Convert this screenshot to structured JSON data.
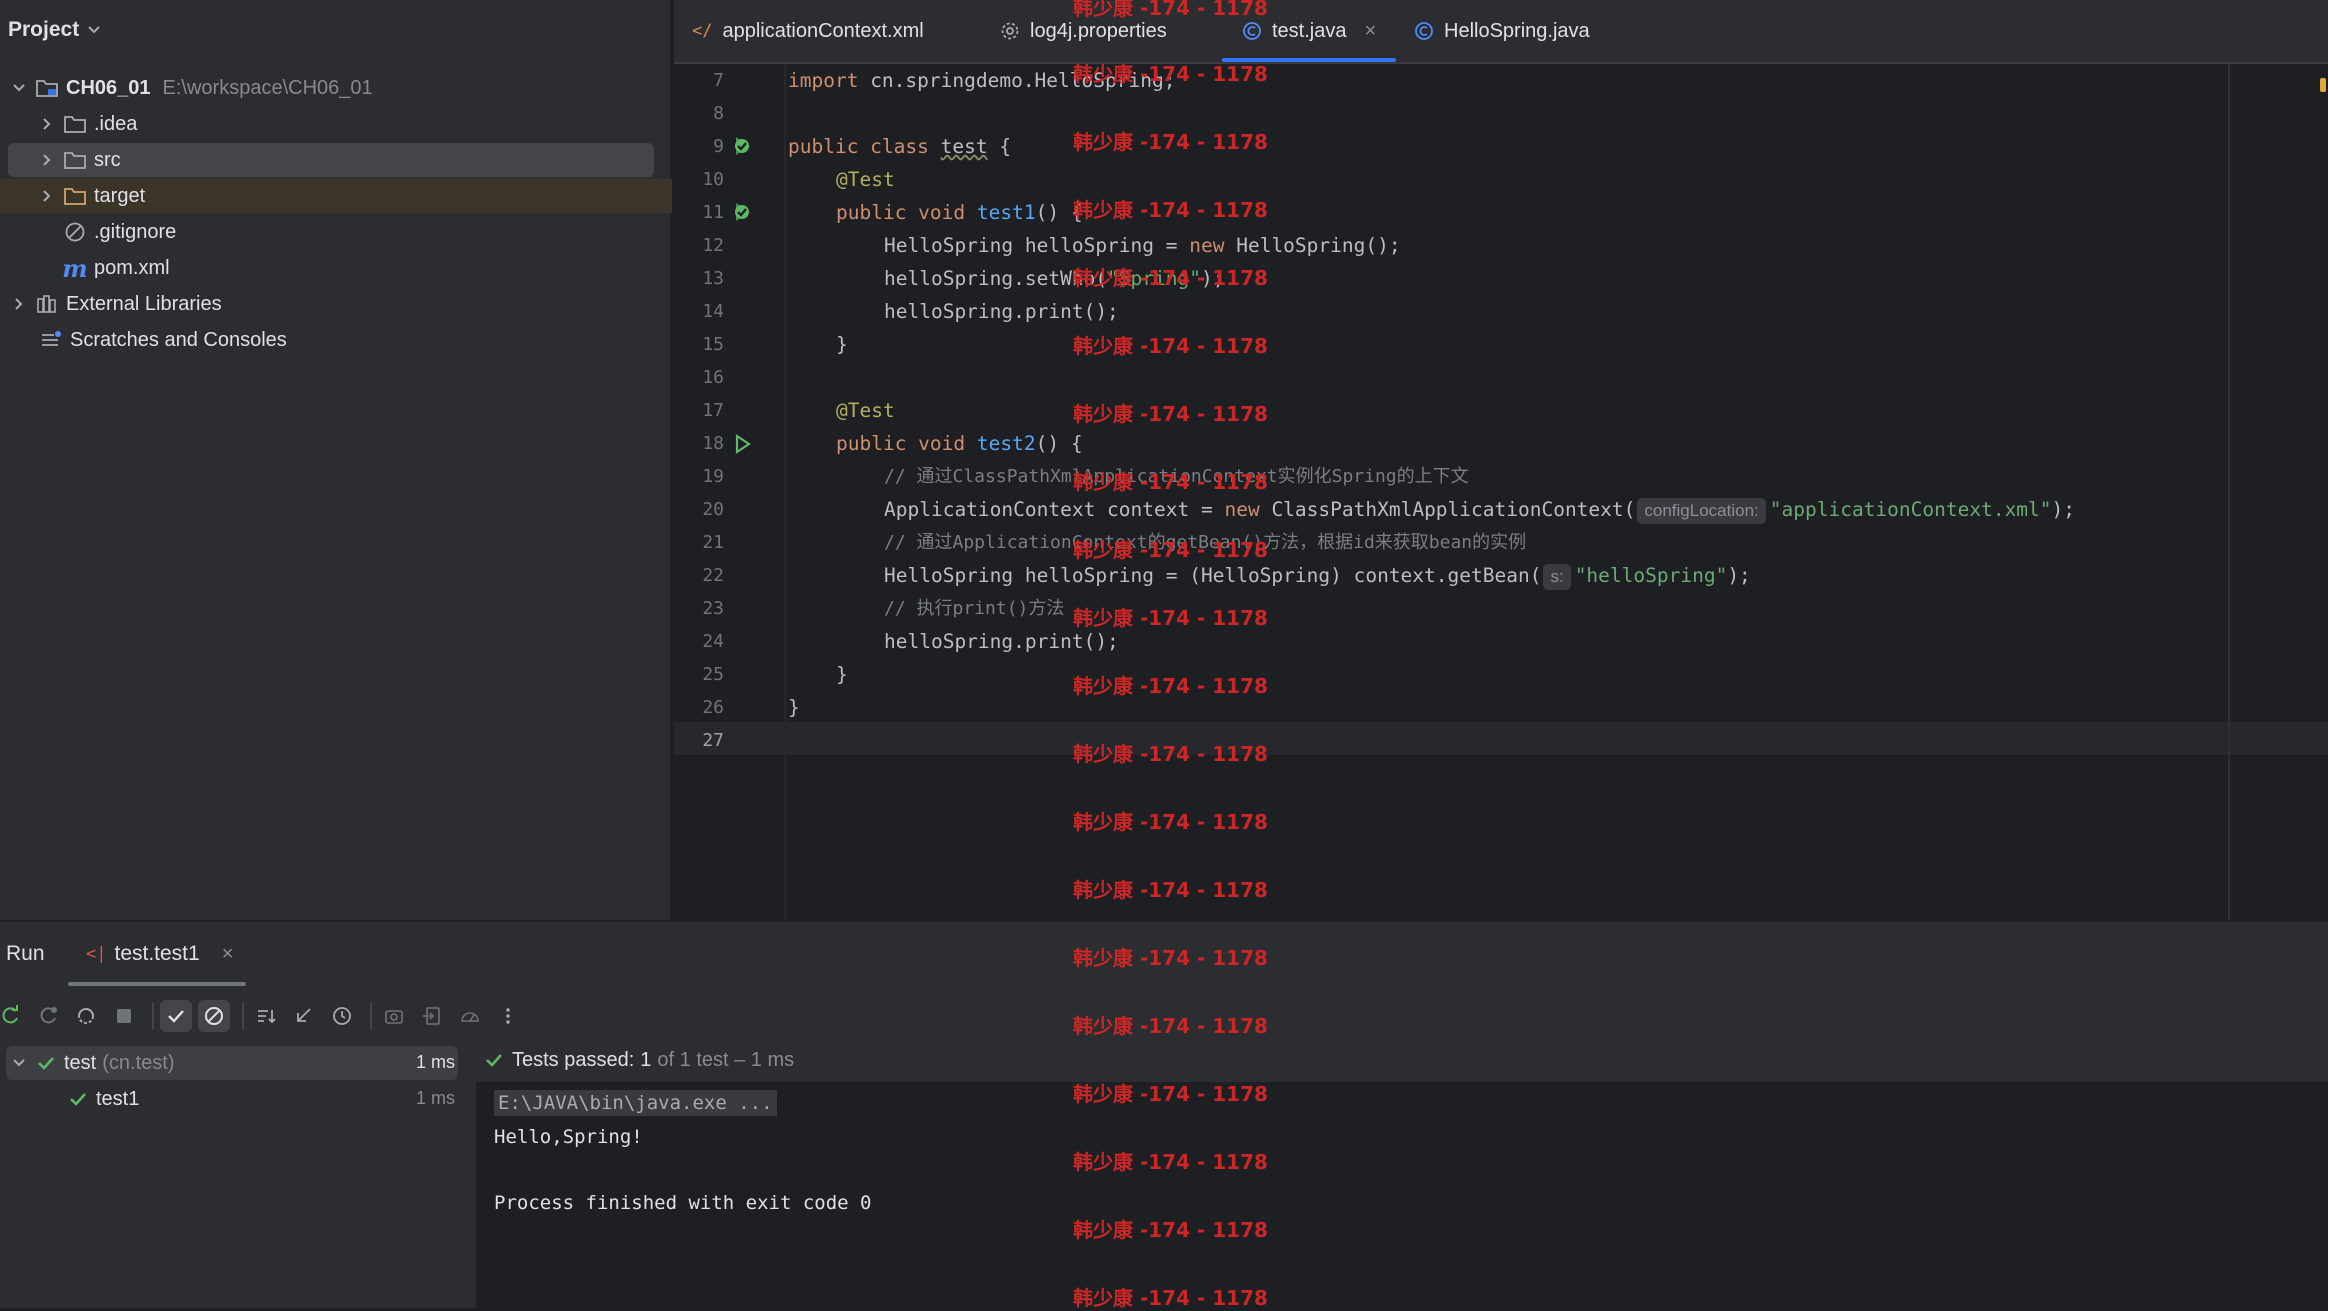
{
  "project": {
    "title": "Project",
    "root": {
      "name": "CH06_01",
      "path": "E:\\workspace\\CH06_01"
    },
    "items": [
      ".idea",
      "src",
      "target",
      ".gitignore",
      "pom.xml"
    ],
    "external_libraries": "External Libraries",
    "scratches": "Scratches and Consoles"
  },
  "tabs": [
    {
      "label": "applicationContext.xml",
      "icon": "xml-icon"
    },
    {
      "label": "log4j.properties",
      "icon": "gear-icon"
    },
    {
      "label": "test.java",
      "icon": "class-icon",
      "active": true
    },
    {
      "label": "HelloSpring.java",
      "icon": "class-icon"
    }
  ],
  "editor": {
    "line_numbers": [
      "7",
      "8",
      "9",
      "10",
      "11",
      "12",
      "13",
      "14",
      "15",
      "16",
      "17",
      "18",
      "19",
      "20",
      "21",
      "22",
      "23",
      "24",
      "25",
      "26",
      "27"
    ],
    "lines": {
      "l7": [
        "import",
        " cn.springdemo.HelloSpring;"
      ],
      "l9": [
        "public class",
        " ",
        "test",
        " {"
      ],
      "l10": "@Test",
      "l11": [
        "public void",
        " ",
        "test1",
        "() {"
      ],
      "l12": [
        "HelloSpring helloSpring = ",
        "new",
        " HelloSpring();"
      ],
      "l13": [
        "helloSpring.setWho(",
        "\"Spring\"",
        ");"
      ],
      "l14": "helloSpring.print();",
      "l15": "}",
      "l17": "@Test",
      "l18": [
        "public void",
        " ",
        "test2",
        "() {"
      ],
      "l19": "// 通过ClassPathXmlApplicationContext实例化Spring的上下文",
      "l20": [
        "ApplicationContext context = ",
        "new",
        " ClassPathXmlApplicationContext(",
        "configLocation:",
        "\"applicationContext.xml\"",
        ");"
      ],
      "l21": "// 通过ApplicationContext的getBean()方法，根据id来获取bean的实例",
      "l22": [
        "HelloSpring helloSpring = (HelloSpring) context.getBean(",
        "s:",
        "\"helloSpring\"",
        ");"
      ],
      "l23": "// 执行print()方法",
      "l24": "helloSpring.print();",
      "l25": "}",
      "l26": "}"
    }
  },
  "run": {
    "title": "Run",
    "tab_label": "test.test1",
    "tree": {
      "suite": "test",
      "suite_pkg": "(cn.test)",
      "suite_time": "1 ms",
      "test": "test1",
      "test_time": "1 ms"
    },
    "status": {
      "prefix": "Tests passed:",
      "count": "1",
      "suffix": "of 1 test – 1 ms"
    },
    "console": [
      "E:\\JAVA\\bin\\java.exe ...",
      "Hello,Spring!",
      "Process finished with exit code 0"
    ]
  },
  "watermark": "韩少康 -174 - 1178",
  "colors": {
    "accent": "#3574f0",
    "pass": "#5fb865",
    "watermark": "#cc2727"
  }
}
